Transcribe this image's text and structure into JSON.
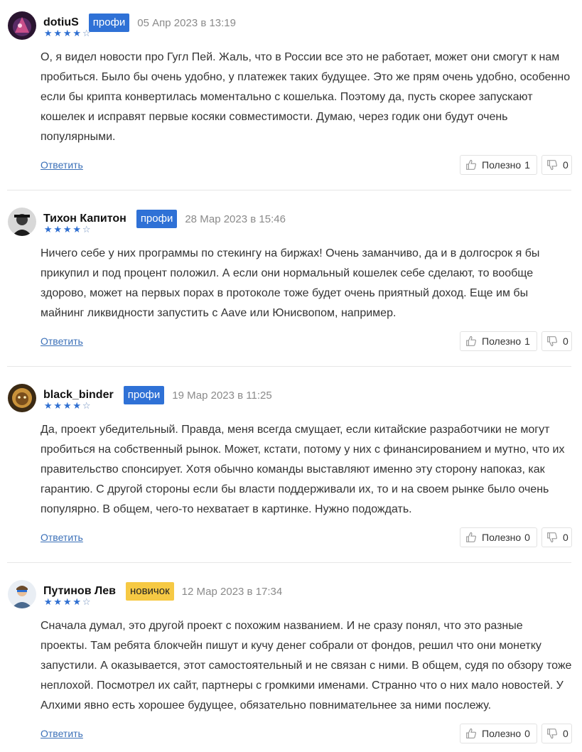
{
  "actions": {
    "reply_label": "Ответить",
    "useful_label": "Полезно"
  },
  "colors": {
    "pro_badge": "#2f71d6",
    "novice_badge": "#f6c944",
    "star": "#2f6fd1",
    "link": "#3b70b8"
  },
  "comments": [
    {
      "author": "dotiuS",
      "badge": "профи",
      "badge_type": "pro",
      "date": "05 Апр 2023 в 13:19",
      "rating": 4,
      "rating_max": 5,
      "text": "О, я видел новости про Гугл Пей. Жаль, что в России все это не работает, может они смогут к нам пробиться. Было бы очень удобно, у платежек таких будущее. Это же прям очень удобно, особенно если бы крипта конвертилась моментально с кошелька. Поэтому да, пусть скорее запускают кошелек и исправят первые косяки совместимости. Думаю, через годик они будут очень популярными.",
      "likes": "1",
      "dislikes": "0"
    },
    {
      "author": "Тихон Капитон",
      "badge": "профи",
      "badge_type": "pro",
      "date": "28 Мар 2023 в 15:46",
      "rating": 4,
      "rating_max": 5,
      "text": "Ничего себе у них программы по стекингу на биржах! Очень заманчиво, да и в долгосрок я бы прикупил и под процент положил. А если они нормальный кошелек себе сделают, то вообще здорово, может на первых порах в протоколе тоже будет очень приятный доход. Еще им бы майнинг ликвидности запустить с Aave или Юнисвопом, например.",
      "likes": "1",
      "dislikes": "0"
    },
    {
      "author": "black_binder",
      "badge": "профи",
      "badge_type": "pro",
      "date": "19 Мар 2023 в 11:25",
      "rating": 4,
      "rating_max": 5,
      "text": "Да, проект убедительный. Правда, меня всегда смущает, если китайские разработчики не могут пробиться на собственный рынок. Может, кстати, потому у них с финансированием и мутно, что их правительство спонсирует. Хотя обычно команды выставляют именно эту сторону напоказ, как гарантию. С другой стороны если бы власти поддерживали их, то и на своем рынке было очень популярно. В общем, чего-то нехватает в картинке. Нужно подождать.",
      "likes": "0",
      "dislikes": "0"
    },
    {
      "author": "Путинов Лев",
      "badge": "новичок",
      "badge_type": "new",
      "date": "12 Мар 2023 в 17:34",
      "rating": 4,
      "rating_max": 5,
      "text": "Сначала думал, это другой проект с похожим названием. И не сразу понял, что это разные проекты. Там ребята блокчейн пишут и кучу денег собрали от фондов, решил что они монетку запустили. А оказывается, этот самостоятельный и не связан с ними. В общем, судя по обзору тоже неплохой. Посмотрел их сайт, партнеры с громкими именами. Странно что о них мало новостей. У Алхими явно есть хорошее будущее, обязательно повнимательнее за ними послежу.",
      "likes": "0",
      "dislikes": "0"
    }
  ]
}
